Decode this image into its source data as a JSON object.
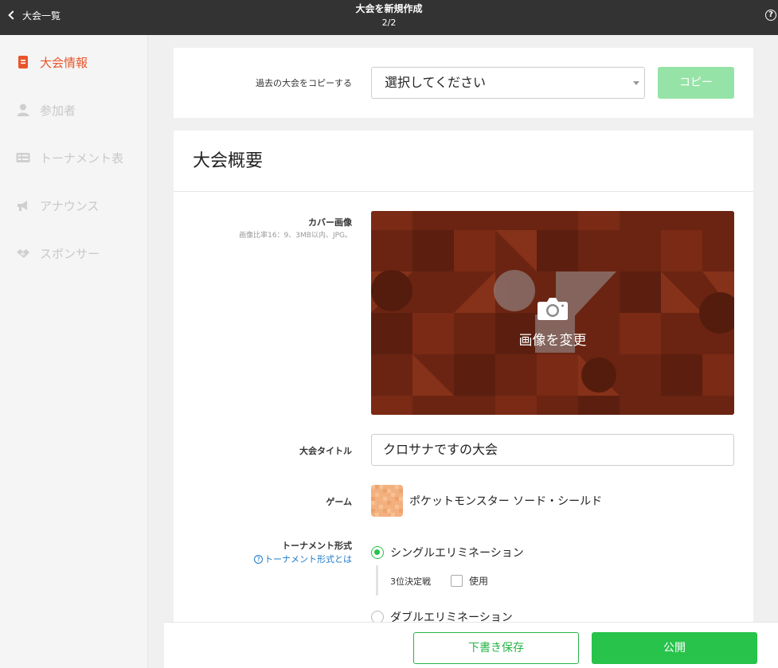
{
  "header": {
    "back_label": "大会一覧",
    "title": "大会を新規作成",
    "step": "2/2",
    "help_glyph": "?"
  },
  "sidebar": {
    "items": [
      {
        "label": "大会情報",
        "icon": "document-icon",
        "active": true
      },
      {
        "label": "参加者",
        "icon": "person-icon",
        "active": false
      },
      {
        "label": "トーナメント表",
        "icon": "bracket-table-icon",
        "active": false
      },
      {
        "label": "アナウンス",
        "icon": "megaphone-icon",
        "active": false
      },
      {
        "label": "スポンサー",
        "icon": "handshake-icon",
        "active": false
      }
    ]
  },
  "copy_section": {
    "label": "過去の大会をコピーする",
    "select_value": "選択してください",
    "copy_button": "コピー"
  },
  "overview": {
    "title": "大会概要",
    "cover": {
      "label": "カバー画像",
      "hint": "画像比率16：9、3MB以内、JPG。",
      "change_label": "画像を変更"
    },
    "tournament_title": {
      "label": "大会タイトル",
      "value": "クロサナですの大会"
    },
    "game": {
      "label": "ゲーム",
      "name": "ポケットモンスター ソード・シールド"
    },
    "format": {
      "label": "トーナメント形式",
      "help_link": "トーナメント形式とは",
      "options": [
        {
          "label": "シングルエリミネーション",
          "selected": true
        },
        {
          "label": "ダブルエリミネーション",
          "selected": false
        }
      ],
      "third_place_label": "3位決定戦",
      "third_place_use": "使用"
    }
  },
  "footer": {
    "draft_button": "下書き保存",
    "publish_button": "公開"
  },
  "colors": {
    "accent_orange": "#e8552b",
    "primary_green": "#27c34a",
    "disabled_green": "#95e3a6",
    "topbar": "#333333",
    "cover_bg": "#6b2412"
  }
}
